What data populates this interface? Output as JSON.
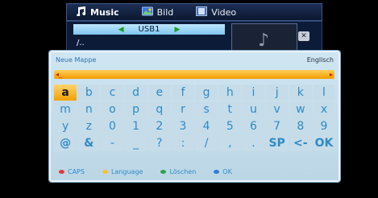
{
  "header": {
    "tabs": [
      {
        "label": "Music",
        "icon": "music-note-icon",
        "active": true
      },
      {
        "label": "Bild",
        "icon": "picture-icon",
        "active": false
      },
      {
        "label": "Video",
        "icon": "film-icon",
        "active": false
      }
    ]
  },
  "browser": {
    "device": "USB1",
    "path": "/.."
  },
  "dialog": {
    "title": "Neue Mappe",
    "language": "Englisch",
    "input_value": "",
    "rows": [
      [
        "a",
        "b",
        "c",
        "d",
        "e",
        "f",
        "g",
        "h",
        "i",
        "j",
        "k",
        "l"
      ],
      [
        "m",
        "n",
        "o",
        "p",
        "q",
        "r",
        "s",
        "t",
        "u",
        "v",
        "w",
        "x"
      ],
      [
        "y",
        "z",
        "0",
        "1",
        "2",
        "3",
        "4",
        "5",
        "6",
        "7",
        "8",
        "9"
      ],
      [
        "@",
        "&",
        "-",
        "_",
        "?",
        ":",
        "/",
        ",",
        ".",
        "SP",
        "<-",
        "OK"
      ]
    ],
    "selected_key": "a",
    "legend": [
      {
        "color": "#e23a3a",
        "label": "CAPS"
      },
      {
        "color": "#f1c232",
        "label": "Language"
      },
      {
        "color": "#2ea34a",
        "label": "Löschen"
      },
      {
        "color": "#2d7fd6",
        "label": "OK"
      }
    ]
  }
}
